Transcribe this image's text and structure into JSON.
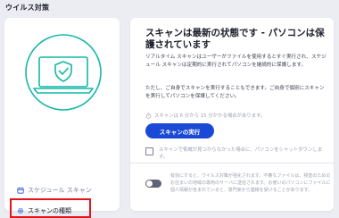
{
  "page": {
    "title": "ウイルス対策"
  },
  "left_panel": {
    "menu": {
      "schedule_label": "スケジュール スキャン",
      "scan_types_label": "スキャンの種類"
    }
  },
  "status": {
    "heading": "スキャンは最新の状態です - パソコンは保護されています",
    "paragraph1": "リアルタイム スキャンはユーザーがファイルを使用するとすぐ実行され、スケジュール スキャンは定期的に実行されてパソコンを継続的に保護します。",
    "paragraph2": "ただし、ご自身でスキャンを実行することもできます。ご自身で個別にスキャンを実行してパソコンを保護してください。",
    "hint": "スキャンは 6 分から 15 分かかる場合があります。",
    "run_scan_label": "スキャンの実行",
    "shutdown_checkbox_label": "スキャンで脅威が見つからなかった場合に、パソコンをシャットダウンします。",
    "toggle_text": "有効にすると、ウイルス対策が強化されます。不審なファイルは、検査のためのお住まいの地域の専用のサーバに送信されます。お使いのパソコンにファイルに個人情報が含まれていると、専門家から連絡を受けることがあります。"
  },
  "colors": {
    "accent": "#1a49d6",
    "highlight": "#e3141b",
    "shield": "#14b8a6"
  },
  "icons": {
    "illustration": "laptop-shield-illustration",
    "schedule": "calendar-icon",
    "scan_types": "gear-icon",
    "hint": "timer-icon"
  }
}
